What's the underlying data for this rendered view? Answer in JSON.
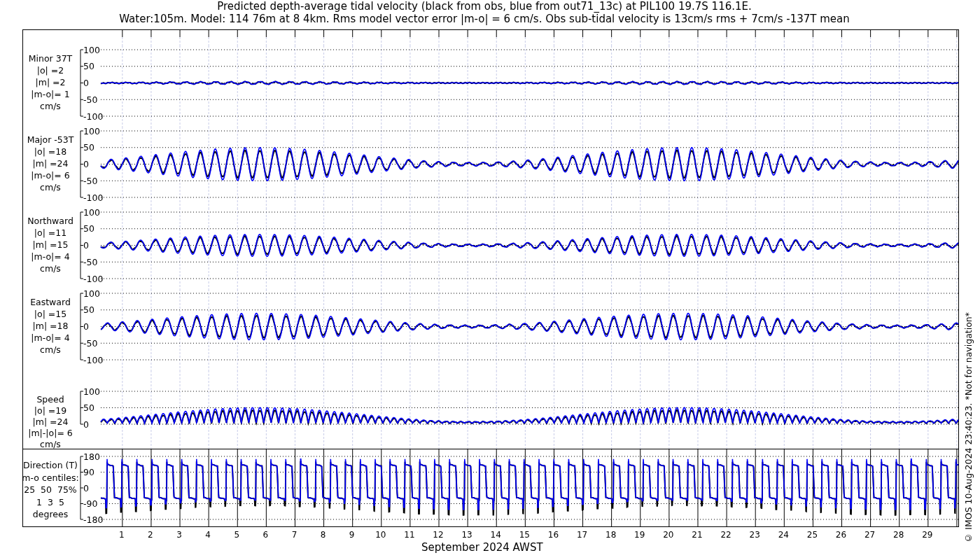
{
  "title": [
    "Predicted depth-average tidal velocity (black from obs, blue from out71_13c) at PIL100 19.7S 116.1E.",
    "Water:105m. Model: 114 76m at 8 4km. Rms model vector error |m-o| = 6 cm/s. Obs sub-tidal velocity is 13cm/s rms + 7cm/s -137T mean"
  ],
  "panels": [
    {
      "kind": "minor",
      "label": [
        "Minor 37T",
        "|o| =2",
        "|m| =2",
        "|m-o|= 1",
        "cm/s"
      ],
      "yticks": [
        "100",
        "50",
        "0",
        "-50",
        "-100"
      ]
    },
    {
      "kind": "major",
      "label": [
        "Major -53T",
        "|o| =18",
        "|m| =24",
        "|m-o|= 6",
        "cm/s"
      ],
      "yticks": [
        "100",
        "50",
        "0",
        "-50",
        "-100"
      ]
    },
    {
      "kind": "north",
      "label": [
        "Northward",
        "|o| =11",
        "|m| =15",
        "|m-o|= 4",
        "cm/s"
      ],
      "yticks": [
        "100",
        "50",
        "0",
        "-50",
        "-100"
      ]
    },
    {
      "kind": "east",
      "label": [
        "Eastward",
        "|o| =15",
        "|m| =18",
        "|m-o|= 4",
        "cm/s"
      ],
      "yticks": [
        "100",
        "50",
        "0",
        "-50",
        "-100"
      ]
    },
    {
      "kind": "speed",
      "label": [
        "Speed",
        "|o| =19",
        "|m| =24",
        "|m|-|o|= 6",
        "cm/s"
      ],
      "yticks": [
        "100",
        "50",
        "0"
      ]
    }
  ],
  "direction_panel": {
    "kind": "direction",
    "label": [
      "Direction (T)",
      "m-o centiles:",
      "25  50  75%",
      "1  3  5",
      "degrees"
    ],
    "yticks": [
      "180",
      "90",
      "0",
      "-90",
      "-180"
    ]
  },
  "xaxis": {
    "ticks": [
      "1",
      "2",
      "3",
      "4",
      "5",
      "6",
      "7",
      "8",
      "9",
      "10",
      "11",
      "12",
      "13",
      "14",
      "15",
      "16",
      "17",
      "18",
      "19",
      "20",
      "21",
      "22",
      "23",
      "24",
      "25",
      "26",
      "27",
      "28",
      "29"
    ],
    "label": "September 2024 AWST"
  },
  "footer_note": "© IMOS 10-Aug-2024 23:40:23. *Not for navigation*"
}
